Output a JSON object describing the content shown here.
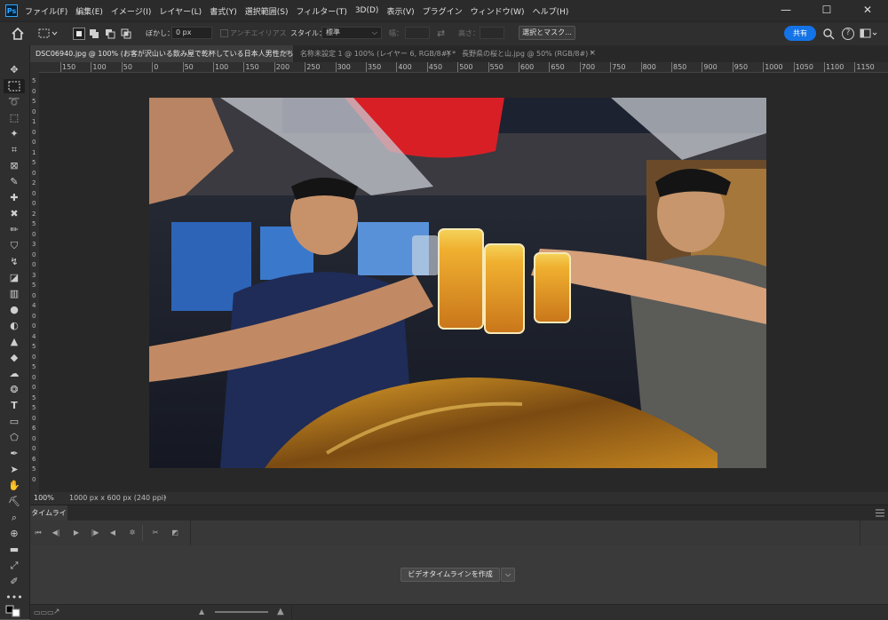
{
  "app": {
    "logo_text": "Ps"
  },
  "menu": [
    "ファイル(F)",
    "編集(E)",
    "イメージ(I)",
    "レイヤー(L)",
    "書式(Y)",
    "選択範囲(S)",
    "フィルター(T)",
    "3D(D)",
    "表示(V)",
    "プラグイン",
    "ウィンドウ(W)",
    "ヘルプ(H)"
  ],
  "window_controls": {
    "minimize": "—",
    "maximize": "☐",
    "close": "✕"
  },
  "options": {
    "feather_label": "ぼかし：",
    "feather_value": "0 px",
    "antialias_label": "アンチエイリアス",
    "style_label": "スタイル：",
    "style_value": "標準",
    "width_label": "幅：",
    "height_label": "高さ：",
    "select_mask_button": "選択とマスク...",
    "share_button": "共有"
  },
  "tabs": [
    {
      "label": "DSC06940.jpg @ 100% (お客が沢山いる飲み屋で乾杯している日本人男性たち, RGB/8) *",
      "close": "×",
      "active": true
    },
    {
      "label": "名称未設定 1 @ 100% (レイヤー 6, RGB/8#) *",
      "close": "×",
      "active": false
    },
    {
      "label": "長野県の桜と山.jpg @ 50% (RGB/8#) *",
      "close": "×",
      "active": false
    }
  ],
  "ruler_top": [
    "150",
    "100",
    "50",
    "0",
    "50",
    "100",
    "150",
    "200",
    "250",
    "300",
    "350",
    "400",
    "450",
    "500",
    "550",
    "600",
    "650",
    "700",
    "750",
    "800",
    "850",
    "900",
    "950",
    "1000",
    "1050",
    "1100",
    "1150"
  ],
  "ruler_left": [
    "5",
    "0",
    "5",
    "0",
    "1",
    "0",
    "0",
    "1",
    "5",
    "0",
    "2",
    "0",
    "0",
    "2",
    "5",
    "0",
    "3",
    "0",
    "0",
    "3",
    "5",
    "0",
    "4",
    "0",
    "0",
    "4",
    "5",
    "0",
    "5",
    "0",
    "0",
    "5",
    "5",
    "0",
    "6",
    "0",
    "0",
    "6",
    "5",
    "0"
  ],
  "photo": {
    "alt_title": "お客が沢山いる飲み屋で乾杯している日本人男性たち"
  },
  "status": {
    "zoom": "100%",
    "doc_size": "1000 px x 600 px (240 ppi)",
    "arrow": "›"
  },
  "timeline": {
    "tab_label": "タイムライン",
    "create_button": "ビデオタイムラインを作成",
    "dropdown_arrow": "⌵"
  }
}
